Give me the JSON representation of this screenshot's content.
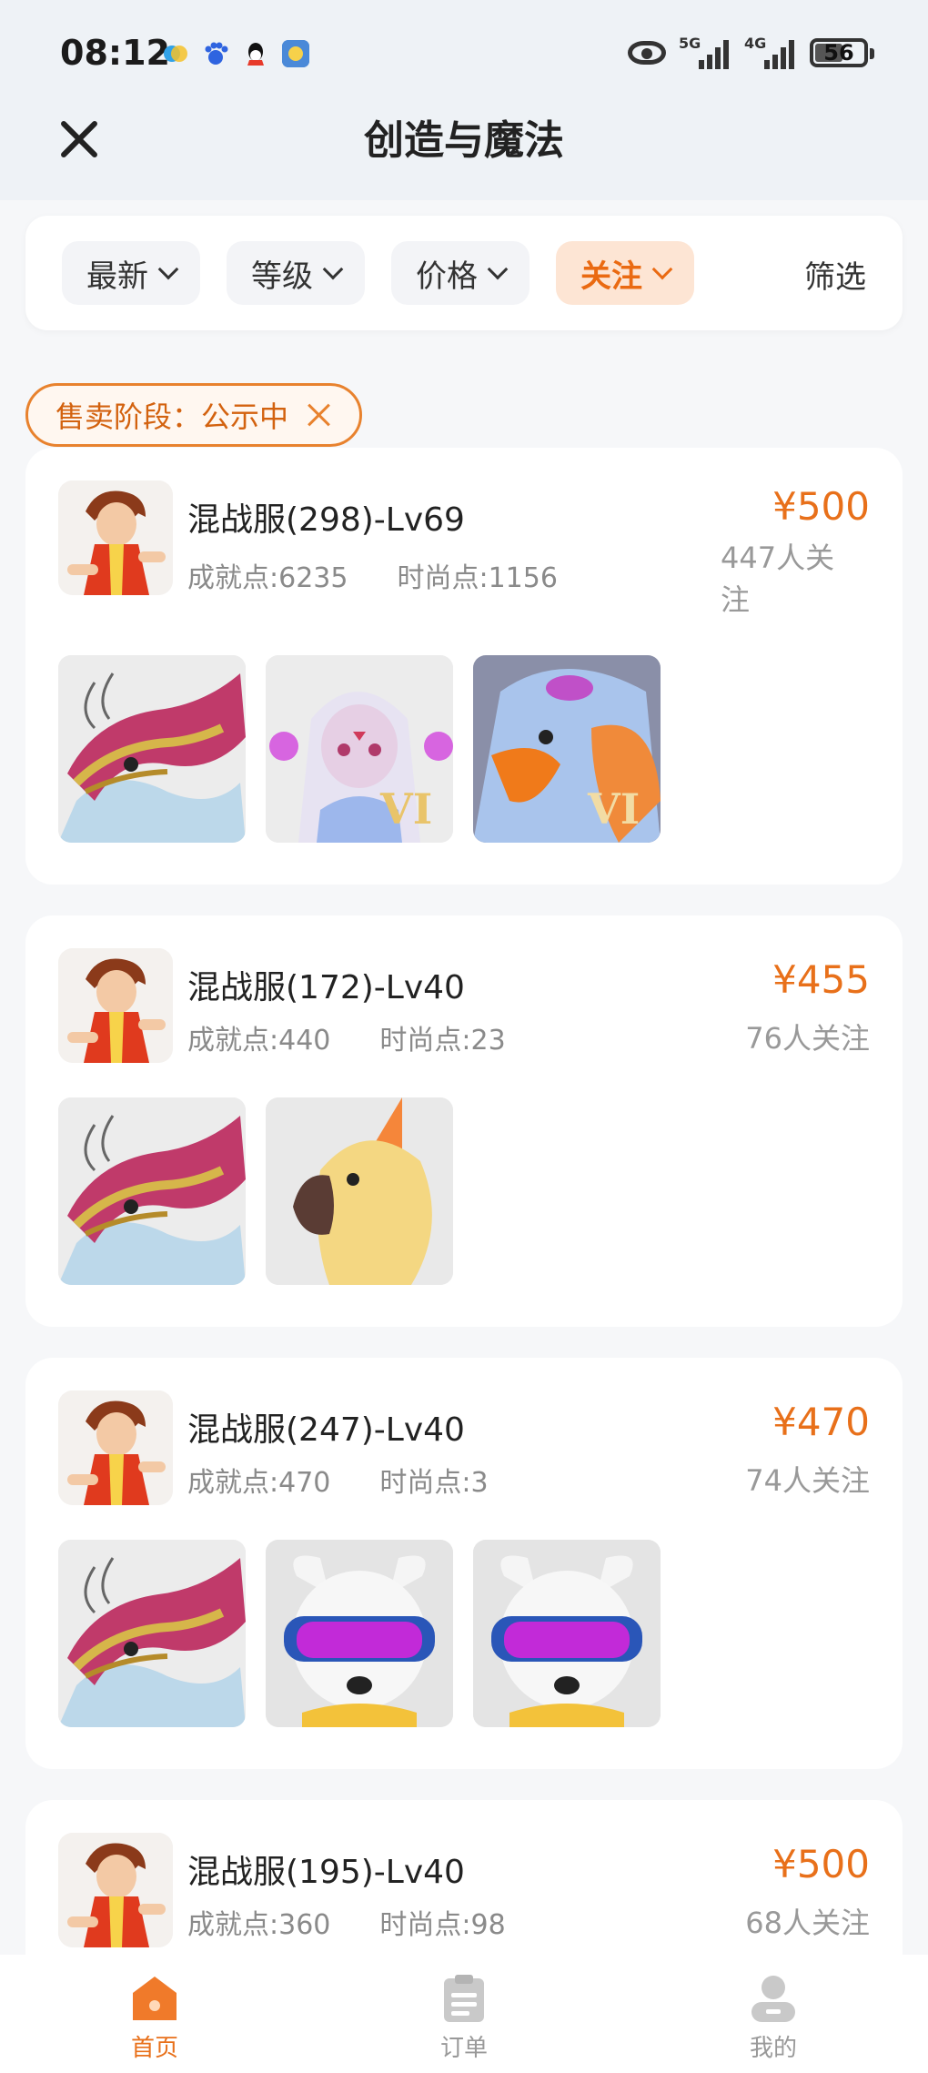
{
  "status_bar": {
    "time": "08:12",
    "signal_1": "5G",
    "signal_2": "4G",
    "battery": "56"
  },
  "header": {
    "title": "创造与魔法"
  },
  "sort_bar": {
    "chips": [
      {
        "label": "最新"
      },
      {
        "label": "等级"
      },
      {
        "label": "价格"
      },
      {
        "label": "关注"
      }
    ],
    "filter_label": "筛选"
  },
  "active_filter": {
    "label": "售卖阶段：公示中"
  },
  "listings": [
    {
      "name": "混战服(298)-Lv69",
      "achievement": "成就点:6235",
      "fashion": "时尚点:1156",
      "price": "¥500",
      "followers": "447人关注",
      "items": [
        "dragon",
        "doll-vi",
        "bird-vi"
      ]
    },
    {
      "name": "混战服(172)-Lv40",
      "achievement": "成就点:440",
      "fashion": "时尚点:23",
      "price": "¥455",
      "followers": "76人关注",
      "items": [
        "dragon",
        "parrot"
      ]
    },
    {
      "name": "混战服(247)-Lv40",
      "achievement": "成就点:470",
      "fashion": "时尚点:3",
      "price": "¥470",
      "followers": "74人关注",
      "items": [
        "dragon",
        "goggle-bear",
        "goggle-bear"
      ]
    },
    {
      "name": "混战服(195)-Lv40",
      "achievement": "成就点:360",
      "fashion": "时尚点:98",
      "price": "¥500",
      "followers": "68人关注",
      "items": []
    }
  ],
  "bottom_nav": {
    "items": [
      {
        "label": "首页",
        "icon": "home-icon"
      },
      {
        "label": "订单",
        "icon": "orders-icon"
      },
      {
        "label": "我的",
        "icon": "profile-icon"
      }
    ]
  },
  "colors": {
    "accent": "#e8701a",
    "active_chip_bg": "#fde5d4"
  }
}
